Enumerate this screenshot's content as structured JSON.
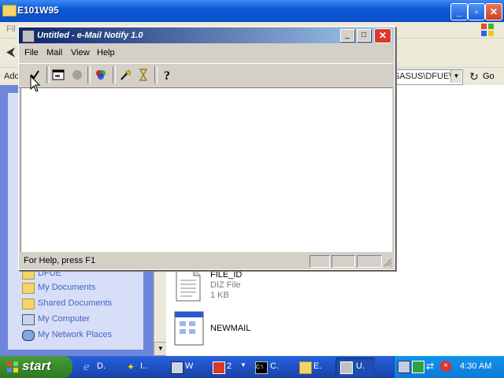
{
  "background_window": {
    "title": "E101W95",
    "menu_file": "Fil",
    "address_label": "Add",
    "address_value": "SASUS\\DFUE\\E",
    "go_label": "Go"
  },
  "task_pane": {
    "places": [
      {
        "label": "DFUE",
        "icon": "folder-icon"
      },
      {
        "label": "My Documents",
        "icon": "folder-icon"
      },
      {
        "label": "Shared Documents",
        "icon": "folder-icon"
      },
      {
        "label": "My Computer",
        "icon": "computer-icon"
      },
      {
        "label": "My Network Places",
        "icon": "network-icon"
      }
    ]
  },
  "files": [
    {
      "name": "FILE_ID",
      "type": "DIZ File",
      "size": "1 KB"
    },
    {
      "name": "NEWMAIL"
    }
  ],
  "app": {
    "title": "Untitled - e-Mail Notify 1.0",
    "menu": [
      "File",
      "Mail",
      "View",
      "Help"
    ],
    "status": "For Help, press F1",
    "toolbar": [
      "check-icon",
      "window-icon",
      "circle-icon",
      "colors-icon",
      "wand-icon",
      "hourglass-icon",
      "help-icon"
    ]
  },
  "taskbar": {
    "start_label": "start",
    "tasks": [
      {
        "label": "D.",
        "icon": "ie-icon"
      },
      {
        "label": "I..",
        "icon": "tool-icon"
      },
      {
        "label": "W",
        "icon": "computer-icon"
      },
      {
        "label": "2",
        "icon": "app-icon"
      },
      {
        "label": "C.",
        "icon": "console-icon"
      },
      {
        "label": "E.",
        "icon": "folder-icon"
      },
      {
        "label": "U.",
        "icon": "mail-notify-icon",
        "active": true
      }
    ],
    "clock": "4:30 AM"
  }
}
